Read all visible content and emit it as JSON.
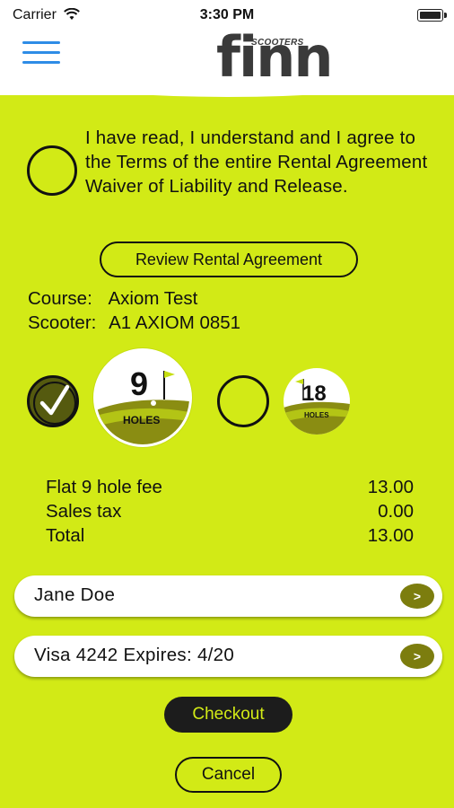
{
  "status_bar": {
    "carrier": "Carrier",
    "time": "3:30 PM"
  },
  "header": {
    "menu_icon": "hamburger-menu-icon",
    "logo_text": "finn",
    "logo_subtext": "SCOOTERS"
  },
  "agreement": {
    "text": "I have read, I understand and I agree to the Terms of the entire Rental Agreement Waiver of Liability and Release.",
    "checked": false,
    "review_button_label": "Review Rental Agreement"
  },
  "details": {
    "course_label": "Course:",
    "course_value": "Axiom Test",
    "scooter_label": "Scooter:",
    "scooter_value": "A1 AXIOM 0851"
  },
  "hole_options": [
    {
      "number": "9",
      "label": "HOLES",
      "selected": true
    },
    {
      "number": "18",
      "label": "HOLES",
      "selected": false
    }
  ],
  "fees": [
    {
      "label": "Flat 9 hole fee",
      "amount": "13.00"
    },
    {
      "label": "Sales tax",
      "amount": "0.00"
    },
    {
      "label": "Total",
      "amount": "13.00"
    }
  ],
  "customer": {
    "name": "Jane Doe",
    "name_chevron": ">"
  },
  "payment": {
    "card": "Visa 4242 Expires: 4/20",
    "card_chevron": ">"
  },
  "actions": {
    "checkout_label": "Checkout",
    "cancel_label": "Cancel"
  },
  "colors": {
    "accent_lime": "#d2ea16",
    "dark_olive": "#7c7d0e",
    "button_dark": "#1c1c1c",
    "menu_blue": "#2e8ce6"
  }
}
